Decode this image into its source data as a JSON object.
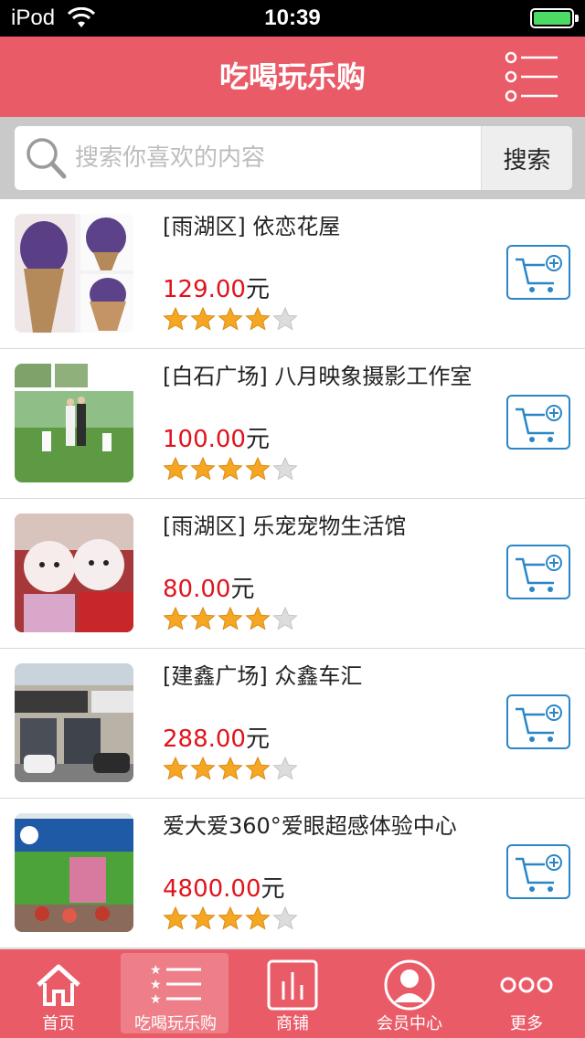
{
  "status_bar": {
    "carrier": "iPod",
    "time": "10:39"
  },
  "header": {
    "title": "吃喝玩乐购"
  },
  "search": {
    "placeholder": "搜索你喜欢的内容",
    "button_label": "搜索"
  },
  "colors": {
    "brand": "#ea5b68",
    "price": "#e0141e",
    "cart_border": "#2a86c7",
    "star": "#f5a623"
  },
  "items": [
    {
      "name": "[雨湖区] 依恋花屋",
      "price": "129.00",
      "unit": "元",
      "rating": 4,
      "rating_max": 5,
      "thumb_icon": "flower-bouquet-photo"
    },
    {
      "name": "[白石广场] 八月映象摄影工作室",
      "price": "100.00",
      "unit": "元",
      "rating": 4,
      "rating_max": 5,
      "thumb_icon": "wedding-photo"
    },
    {
      "name": "[雨湖区] 乐宠宠物生活馆",
      "price": "80.00",
      "unit": "元",
      "rating": 4,
      "rating_max": 5,
      "thumb_icon": "pet-dogs-photo"
    },
    {
      "name": "[建鑫广场] 众鑫车汇",
      "price": "288.00",
      "unit": "元",
      "rating": 4,
      "rating_max": 5,
      "thumb_icon": "car-shop-photo"
    },
    {
      "name": "爱大爱360°爱眼超感体验中心",
      "price": "4800.00",
      "unit": "元",
      "rating": 4,
      "rating_max": 5,
      "thumb_icon": "storefront-photo"
    }
  ],
  "tabs": [
    {
      "label": "首页",
      "icon": "home-icon",
      "active": false
    },
    {
      "label": "吃喝玩乐购",
      "icon": "star-list-icon",
      "active": true
    },
    {
      "label": "商铺",
      "icon": "bar-chart-icon",
      "active": false
    },
    {
      "label": "会员中心",
      "icon": "user-icon",
      "active": false
    },
    {
      "label": "更多",
      "icon": "more-icon",
      "active": false
    }
  ]
}
